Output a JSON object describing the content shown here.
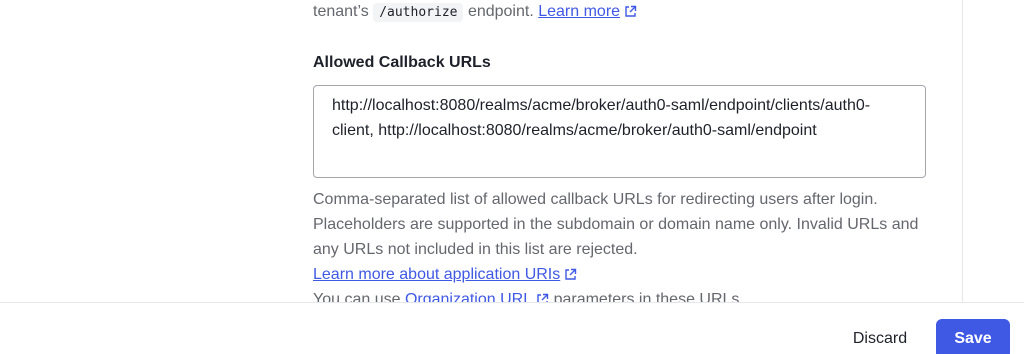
{
  "top_description": {
    "prefix": "tenant’s",
    "code": "/authorize",
    "suffix": "endpoint.",
    "link": "Learn more"
  },
  "callback_field": {
    "label": "Allowed Callback URLs",
    "value": "http://localhost:8080/realms/acme/broker/auth0-saml/endpoint/clients/auth0-client, http://localhost:8080/realms/acme/broker/auth0-saml/endpoint",
    "help_text": "Comma-separated list of allowed callback URLs for redirecting users after login. Placeholders are supported in the subdomain or domain name only. Invalid URLs and any URLs not included in this list are rejected.",
    "help_link": "Learn more about application URIs",
    "org_prefix": "You can use",
    "org_link": "Organization URL",
    "org_suffix": "parameters in these URLs."
  },
  "footer": {
    "discard_label": "Discard",
    "save_label": "Save"
  },
  "icons": {
    "external_link": "external-link-icon"
  },
  "colors": {
    "accent": "#3f59e4",
    "text": "#1e212a",
    "muted": "#65676e",
    "border": "#a3a6ad"
  }
}
